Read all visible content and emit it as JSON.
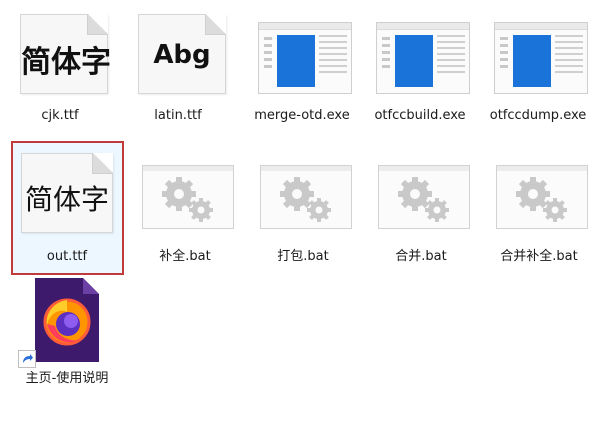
{
  "files": {
    "cjk": {
      "label": "cjk.ttf",
      "sample": "简体字"
    },
    "latin": {
      "label": "latin.ttf",
      "sample": "Abg"
    },
    "merge": {
      "label": "merge-otd.exe"
    },
    "build": {
      "label": "otfccbuild.exe"
    },
    "dump": {
      "label": "otfccdump.exe"
    },
    "out": {
      "label": "out.ttf",
      "sample": "简体字"
    },
    "bat1": {
      "label": "补全.bat"
    },
    "bat2": {
      "label": "打包.bat"
    },
    "bat3": {
      "label": "合并.bat"
    },
    "bat4": {
      "label": "合并补全.bat"
    },
    "shortcut": {
      "label": "主页-使用说明"
    }
  },
  "colors": {
    "selection_border": "#c0393b",
    "exe_blue": "#1a73d9",
    "firefox_purple": "#3d1a6b"
  }
}
